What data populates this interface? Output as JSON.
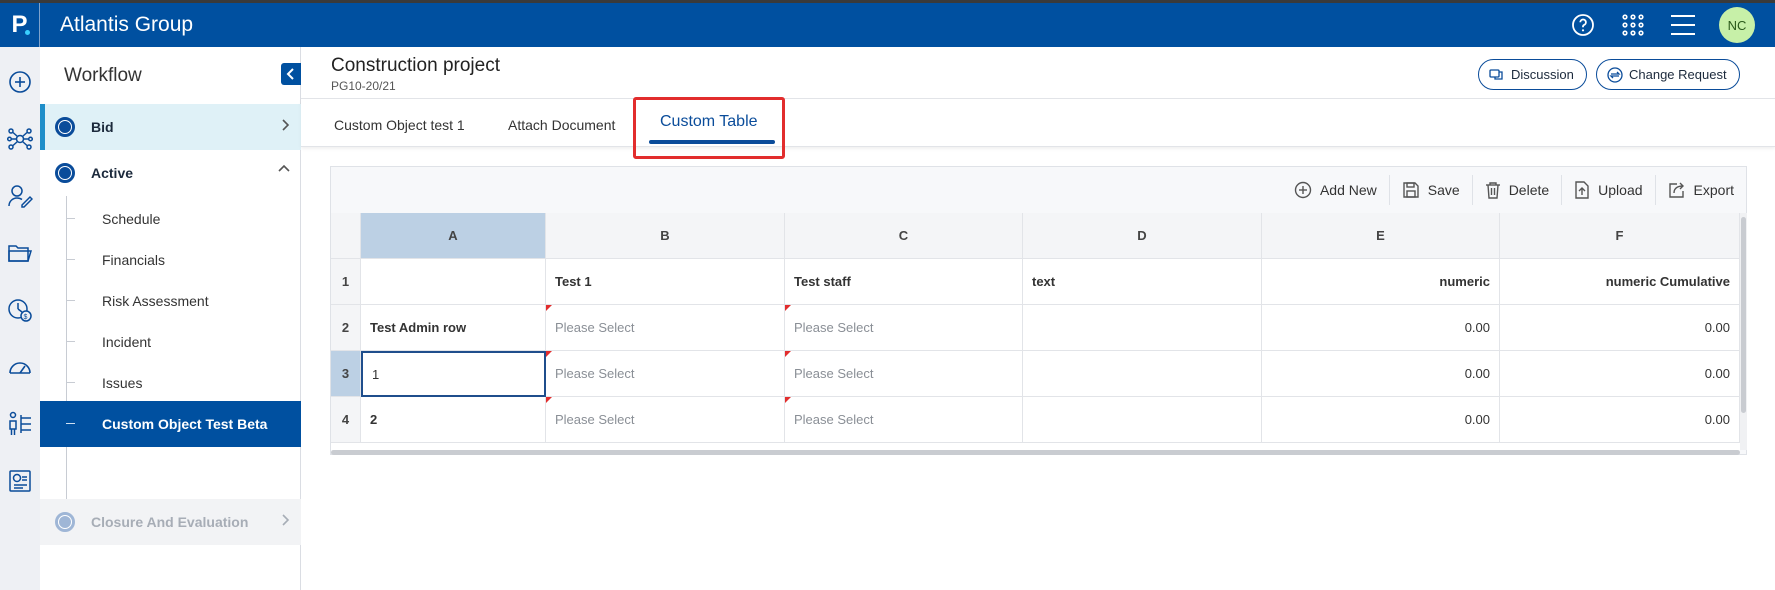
{
  "app": {
    "logo_letter": "P",
    "title": "Atlantis Group",
    "avatar_initials": "NC"
  },
  "topbar": {
    "icons": [
      "help-icon",
      "apps-grid-icon",
      "menu-icon"
    ]
  },
  "rail": {
    "icons": [
      "add-circle-icon",
      "network-icon",
      "user-edit-icon",
      "folder-icon",
      "finance-icon",
      "speedometer-icon",
      "people-hierarchy-icon",
      "report-icon"
    ]
  },
  "workflow": {
    "title": "Workflow",
    "stages": [
      {
        "label": "Bid"
      },
      {
        "label": "Active"
      },
      {
        "label": "Closure And Evaluation"
      }
    ],
    "sub_items": [
      {
        "label": "Schedule"
      },
      {
        "label": "Financials"
      },
      {
        "label": "Risk Assessment"
      },
      {
        "label": "Incident"
      },
      {
        "label": "Issues"
      },
      {
        "label": "Custom Object Test Beta"
      }
    ]
  },
  "header": {
    "title": "Construction project",
    "code": "PG10-20/21",
    "discussion_label": "Discussion",
    "change_request_label": "Change Request"
  },
  "tabs": [
    {
      "label": "Custom Object test 1"
    },
    {
      "label": "Attach Document"
    },
    {
      "label": "Custom Table"
    }
  ],
  "toolbar": {
    "add_new": "Add New",
    "save": "Save",
    "delete": "Delete",
    "upload": "Upload",
    "export": "Export"
  },
  "table": {
    "columns": [
      "A",
      "B",
      "C",
      "D",
      "E",
      "F"
    ],
    "row_numbers": [
      "1",
      "2",
      "3",
      "4"
    ],
    "rows": [
      [
        "",
        "Test 1",
        "Test staff",
        "text",
        "numeric",
        "numeric Cumulative"
      ],
      [
        "Test Admin row",
        "Please Select",
        "Please Select",
        "",
        "0.00",
        "0.00"
      ],
      [
        "1",
        "Please Select",
        "Please Select",
        "",
        "0.00",
        "0.00"
      ],
      [
        "2",
        "Please Select",
        "Please Select",
        "",
        "0.00",
        "0.00"
      ]
    ]
  },
  "colors": {
    "brand_blue": "#0050a0",
    "highlight_red": "#e22d2d",
    "selection_blue": "#bcd0e4"
  }
}
